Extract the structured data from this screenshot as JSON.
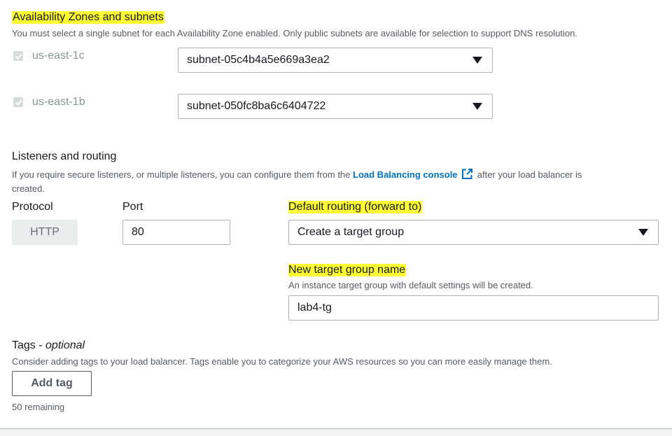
{
  "az_section": {
    "title": "Availability Zones and subnets",
    "description": "You must select a single subnet for each Availability Zone enabled. Only public subnets are available for selection to support DNS resolution.",
    "zones": [
      {
        "name": "us-east-1c",
        "checked": true,
        "subnet": "subnet-05c4b4a5e669a3ea2"
      },
      {
        "name": "us-east-1b",
        "checked": true,
        "subnet": "subnet-050fc8ba6c6404722"
      }
    ]
  },
  "listeners": {
    "title": "Listeners and routing",
    "desc_before": "If you require secure listeners, or multiple listeners, you can configure them from the",
    "link": "Load Balancing console",
    "desc_after": "after your load balancer is",
    "desc_line2": "created.",
    "protocol_label": "Protocol",
    "protocol_value": "HTTP",
    "port_label": "Port",
    "port_value": "80",
    "routing_label": "Default routing (forward to)",
    "routing_value": "Create a target group",
    "tg_label": "New target group name",
    "tg_desc": "An instance target group with default settings will be created.",
    "tg_value": "lab4-tg"
  },
  "tags": {
    "title": "Tags -",
    "title_optional": "optional",
    "description": "Consider adding tags to your load balancer. Tags enable you to categorize your AWS resources so you can more easily manage them.",
    "add_button": "Add tag",
    "remaining": "50 remaining"
  },
  "colors": {
    "highlight": "#ffff33",
    "link": "#0073bb"
  }
}
